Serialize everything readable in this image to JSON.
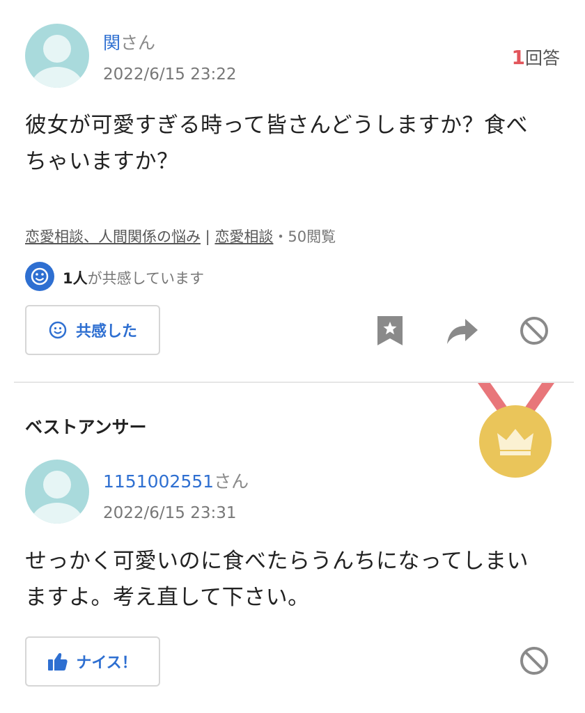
{
  "question": {
    "user_name": "関",
    "user_suffix": "さん",
    "date": "2022/6/15 23:22",
    "answer_count": "1",
    "answer_count_label": "回答",
    "text_line1": "彼女が可愛すぎる時って皆さんどうしますか？食べ",
    "text_line2": "ちゃいますか？",
    "category1": "恋愛相談、人間関係の悩み",
    "separator": " | ",
    "category2": "恋愛相談",
    "views": "・50閲覧",
    "empathy_count": "1人",
    "empathy_text": "が共感しています",
    "empathy_button": "共感した"
  },
  "best_answer": {
    "section_title": "ベストアンサー",
    "user_name": "1151002551",
    "user_suffix": "さん",
    "date": "2022/6/15 23:31",
    "text_line1": "せっかく可愛いのに食べたらうんちになってしまい",
    "text_line2": "ますよ。考え直して下さい。",
    "nice_button": "ナイス！"
  },
  "icons": {
    "bookmark": "bookmark-icon",
    "share": "share-icon",
    "block": "block-icon",
    "smile": "smile-icon",
    "thumbs_up": "thumbs-up-icon",
    "medal": "medal-icon"
  },
  "colors": {
    "accent": "#2e6fd1",
    "answer_count": "#e2555b",
    "avatar": "#a9dadc",
    "medal_gold": "#eac55a",
    "ribbon": "#e8767a"
  }
}
